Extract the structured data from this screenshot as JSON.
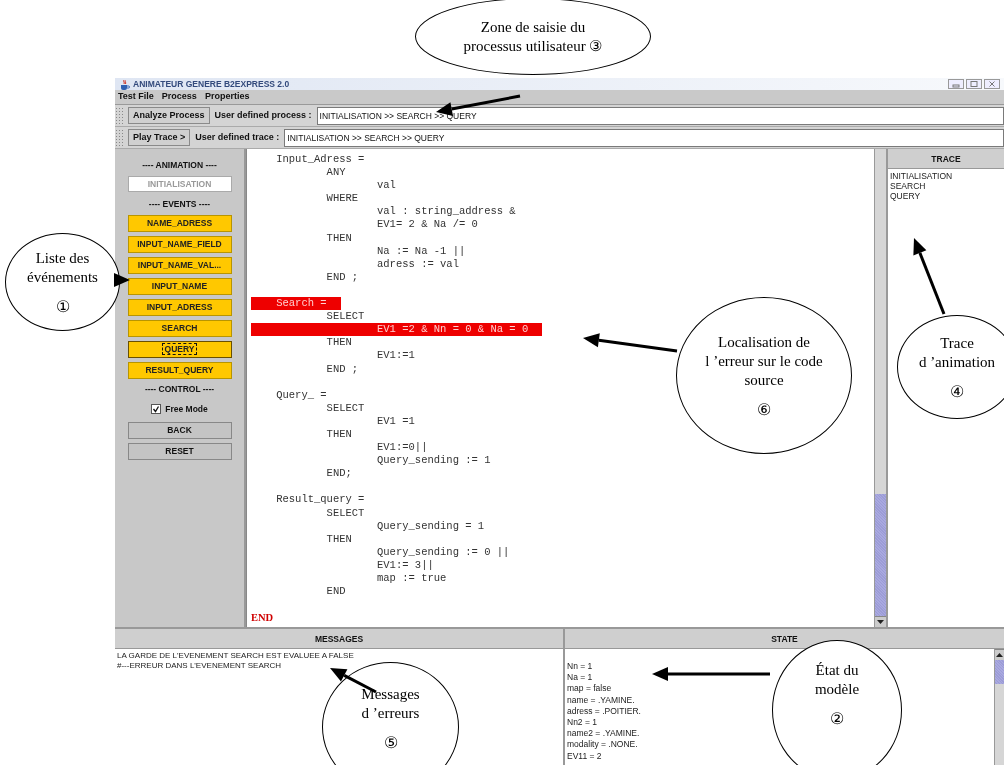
{
  "window": {
    "title": "ANIMATEUR GENERE B2EXPRESS 2.0"
  },
  "menu": [
    "Test File",
    "Process",
    "Properties"
  ],
  "process_bar": {
    "button": "Analyze Process",
    "label": "User defined process :",
    "value": "INITIALISATION >> SEARCH >> QUERY"
  },
  "trace_bar": {
    "button": "Play Trace >",
    "label": "User defined trace :",
    "value": "INITIALISATION >> SEARCH >> QUERY"
  },
  "animation_panel": {
    "heading": "---- ANIMATION ----",
    "initial_button": {
      "label": "INITIALISATION",
      "disabled": true
    },
    "events_heading": "---- EVENTS ----",
    "events": [
      {
        "label": "NAME_ADRESS",
        "focused": false
      },
      {
        "label": "INPUT_NAME_FIELD",
        "focused": false
      },
      {
        "label": "INPUT_NAME_VAL...",
        "focused": false
      },
      {
        "label": "INPUT_NAME",
        "focused": false
      },
      {
        "label": "INPUT_ADRESS",
        "focused": false
      },
      {
        "label": "SEARCH",
        "focused": false
      },
      {
        "label": "QUERY",
        "focused": true
      },
      {
        "label": "RESULT_QUERY",
        "focused": false
      }
    ],
    "control_heading": "---- CONTROL ----",
    "free_mode": {
      "label": "Free Mode",
      "checked": true
    },
    "controls": [
      "BACK",
      "RESET"
    ]
  },
  "code": [
    {
      "kind": "code",
      "text": "    Input_Adress =",
      "highlighted": false
    },
    {
      "kind": "code",
      "text": "            ANY",
      "highlighted": false
    },
    {
      "kind": "code",
      "text": "                    val",
      "highlighted": false
    },
    {
      "kind": "code",
      "text": "            WHERE",
      "highlighted": false
    },
    {
      "kind": "code",
      "text": "                    val : string_address &",
      "highlighted": false
    },
    {
      "kind": "code",
      "text": "                    EV1= 2 & Na /= 0",
      "highlighted": false
    },
    {
      "kind": "code",
      "text": "            THEN",
      "highlighted": false
    },
    {
      "kind": "code",
      "text": "                    Na := Na -1 ||",
      "highlighted": false
    },
    {
      "kind": "code",
      "text": "                    adress := val",
      "highlighted": false
    },
    {
      "kind": "code",
      "text": "            END ;",
      "highlighted": false
    },
    {
      "kind": "blank"
    },
    {
      "kind": "code",
      "text": "    Search =",
      "highlighted": true
    },
    {
      "kind": "code",
      "text": "            SELECT",
      "highlighted": false
    },
    {
      "kind": "code",
      "text": "                    EV1 =2 & Nn = 0 & Na = 0",
      "highlighted": true
    },
    {
      "kind": "code",
      "text": "            THEN",
      "highlighted": false
    },
    {
      "kind": "code",
      "text": "                    EV1:=1",
      "highlighted": false
    },
    {
      "kind": "code",
      "text": "            END ;",
      "highlighted": false
    },
    {
      "kind": "blank"
    },
    {
      "kind": "code",
      "text": "    Query_ =",
      "highlighted": false
    },
    {
      "kind": "code",
      "text": "            SELECT",
      "highlighted": false
    },
    {
      "kind": "code",
      "text": "                    EV1 =1",
      "highlighted": false
    },
    {
      "kind": "code",
      "text": "            THEN",
      "highlighted": false
    },
    {
      "kind": "code",
      "text": "                    EV1:=0||",
      "highlighted": false
    },
    {
      "kind": "code",
      "text": "                    Query_sending := 1",
      "highlighted": false
    },
    {
      "kind": "code",
      "text": "            END;",
      "highlighted": false
    },
    {
      "kind": "blank"
    },
    {
      "kind": "code",
      "text": "    Result_query =",
      "highlighted": false
    },
    {
      "kind": "code",
      "text": "            SELECT",
      "highlighted": false
    },
    {
      "kind": "code",
      "text": "                    Query_sending = 1",
      "highlighted": false
    },
    {
      "kind": "code",
      "text": "            THEN",
      "highlighted": false
    },
    {
      "kind": "code",
      "text": "                    Query_sending := 0 ||",
      "highlighted": false
    },
    {
      "kind": "code",
      "text": "                    EV1:= 3||",
      "highlighted": false
    },
    {
      "kind": "code",
      "text": "                    map := true",
      "highlighted": false
    },
    {
      "kind": "code",
      "text": "            END",
      "highlighted": false
    },
    {
      "kind": "blank"
    },
    {
      "kind": "end",
      "text": "END"
    }
  ],
  "trace": {
    "title": "TRACE",
    "items": [
      "INITIALISATION",
      "SEARCH",
      "QUERY"
    ]
  },
  "messages": {
    "title": "MESSAGES",
    "lines": [
      "LA GARDE DE L'EVENEMENT SEARCH EST EVALUEE A FALSE",
      "#---ERREUR DANS L'EVENEMENT SEARCH"
    ]
  },
  "state": {
    "title": "STATE",
    "lines": [
      "Nn = 1",
      "Na = 1",
      "map = false",
      "name = .YAMINE.",
      "adress = .POITIER.",
      "Nn2 = 1",
      "name2 = .YAMINE.",
      "modality = .NONE.",
      "EV11 = 2"
    ]
  },
  "callouts": [
    {
      "lines": [
        "Zone de saisie du",
        "processus utilisateur ③"
      ]
    },
    {
      "lines": [
        "Liste des",
        "événements"
      ],
      "number": "①"
    },
    {
      "lines": [
        "Localisation de",
        "l ’erreur sur le code",
        "source"
      ],
      "number": "⑥"
    },
    {
      "lines": [
        "Trace",
        "d ’animation"
      ],
      "number": "④"
    },
    {
      "lines": [
        "Messages",
        "d ’erreurs"
      ],
      "number": "⑤"
    },
    {
      "lines": [
        "État du",
        "modèle"
      ],
      "number": "②"
    }
  ]
}
